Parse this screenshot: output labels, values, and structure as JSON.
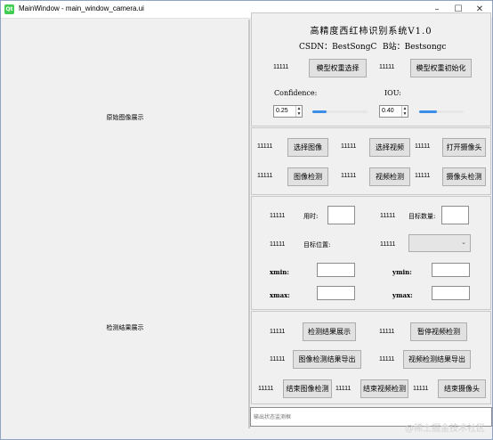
{
  "window": {
    "title": "MainWindow - main_window_camera.ui",
    "logo_text": "Qt",
    "minimize_glyph": "–",
    "maximize_glyph": "☐",
    "close_glyph": "✕"
  },
  "left_panes": {
    "original_label": "原始图像展示",
    "result_label": "检测结果展示"
  },
  "header": {
    "title": "高精度西红柿识别系统V1.0",
    "csdn_label": "CSDN：BestSongC",
    "bilibili_label": "B站：Bestsongc"
  },
  "model_group": {
    "num1": "11111",
    "select_weights": "模型权重选择",
    "num2": "11111",
    "init_model": "模型权重初始化",
    "confidence_label": "Confidence:",
    "confidence_value": "0.25",
    "confidence_level": 0.25,
    "iou_label": "IOU:",
    "iou_value": "0.40",
    "iou_level": 0.4
  },
  "input_group": {
    "row1": [
      {
        "num": "11111",
        "label": "选择图像"
      },
      {
        "num": "11111",
        "label": "选择视频"
      },
      {
        "num": "11111",
        "label": "打开摄像头"
      }
    ],
    "row2": [
      {
        "num": "11111",
        "label": "图像检测"
      },
      {
        "num": "11111",
        "label": "视频检测"
      },
      {
        "num": "11111",
        "label": "摄像头检测"
      }
    ]
  },
  "info_group": {
    "num1": "11111",
    "time_label": "用时:",
    "num2": "11111",
    "count_label": "目标数量:",
    "num3": "11111",
    "position_label": "目标位置:",
    "num4": "11111",
    "xmin_label": "xmin:",
    "ymin_label": "ymin:",
    "xmax_label": "xmax:",
    "ymax_label": "ymax:"
  },
  "output_group": {
    "num1": "11111",
    "show_results": "检测结果展示",
    "num2": "11111",
    "pause_video": "暂停视频检测",
    "num3": "11111",
    "export_image": "图像检测结果导出",
    "num4": "11111",
    "export_video": "视频检测结果导出",
    "num5": "11111",
    "end_image": "结束图像检测",
    "num6": "11111",
    "end_video": "结束视频检测",
    "num7": "11111",
    "end_camera": "结束摄像头"
  },
  "status_bar": {
    "placeholder": "输出状态监测框"
  },
  "watermark": "@稀土掘金技术社区",
  "colors": {
    "slider_fill": "#3c8ee8",
    "qt_logo": "#41cd52"
  },
  "icons": {
    "window_logo": "qt-logo-icon",
    "combo_arrow": "chevron-down-icon"
  }
}
